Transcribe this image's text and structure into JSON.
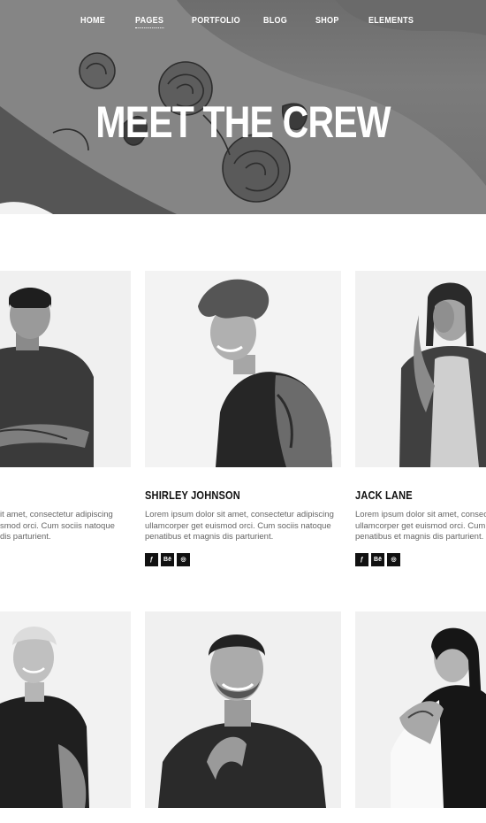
{
  "nav": {
    "items": [
      "HOME",
      "PAGES",
      "PORTFOLIO",
      "BLOG",
      "SHOP",
      "ELEMENTS"
    ],
    "active": "PAGES"
  },
  "hero": {
    "title": "MEET THE CREW"
  },
  "members": [
    {
      "name": "",
      "desc_lines": [
        "it amet, consectetur adipiscing",
        "smod orci. Cum sociis natoque",
        "dis parturient."
      ]
    },
    {
      "name": "SHIRLEY JOHNSON",
      "desc_lines": [
        "Lorem ipsum dolor sit amet, consectetur adipiscing",
        "ullamcorper get euismod orci. Cum sociis natoque",
        "penatibus et magnis dis parturient."
      ],
      "social": [
        "foursquare-icon",
        "behance-icon",
        "instagram-icon"
      ]
    },
    {
      "name": "JACK LANE",
      "desc_lines": [
        "Lorem ipsum dolor sit amet, consectetur adipiscing",
        "ullamcorper get euismod orci. Cum sociis natoque",
        "penatibus et magnis dis parturient."
      ],
      "social": [
        "foursquare-icon",
        "behance-icon",
        "instagram-icon"
      ]
    }
  ],
  "social_labels": {
    "foursquare": "ƒ",
    "behance": "Bē",
    "instagram": "◎"
  },
  "colors": {
    "hero_bg": "#707070",
    "text_dark": "#111111",
    "text_body": "#666666",
    "icon_bg": "#111111"
  }
}
